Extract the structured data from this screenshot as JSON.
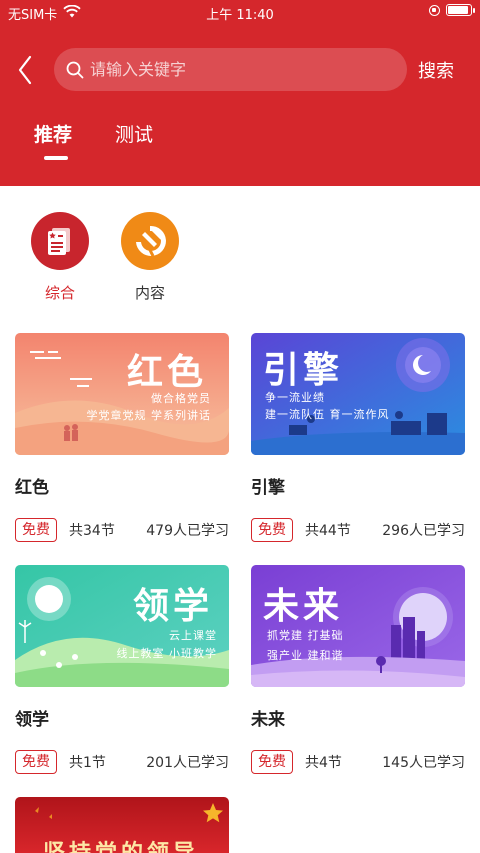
{
  "status_bar": {
    "carrier": "无SIM卡",
    "time": "上午 11:40"
  },
  "search": {
    "placeholder": "请输入关键字",
    "button_label": "搜索"
  },
  "tabs": [
    {
      "label": "推荐",
      "active": true
    },
    {
      "label": "测试",
      "active": false
    }
  ],
  "categories": [
    {
      "label": "综合",
      "icon": "news-document-icon",
      "color": "#c8252d",
      "active": true
    },
    {
      "label": "内容",
      "icon": "party-emblem-icon",
      "color": "#f08a16",
      "active": false
    }
  ],
  "courses": [
    {
      "title": "红色",
      "banner": {
        "title": "红色",
        "lines": [
          "做合格党员",
          "学党章党规  学系列讲话"
        ]
      },
      "badge": "免费",
      "lessons": "共34节",
      "learners": "479人已学习"
    },
    {
      "title": "引擎",
      "banner": {
        "title": "引擎",
        "lines": [
          "争一流业绩",
          "建一流队伍  育一流作风"
        ]
      },
      "badge": "免费",
      "lessons": "共44节",
      "learners": "296人已学习"
    },
    {
      "title": "领学",
      "banner": {
        "title": "领学",
        "lines": [
          "云上课堂",
          "线上教室  小班教学"
        ]
      },
      "badge": "免费",
      "lessons": "共1节",
      "learners": "201人已学习"
    },
    {
      "title": "未来",
      "banner": {
        "title": "未来",
        "lines": [
          "抓党建  打基础",
          "强产业  建和谐"
        ]
      },
      "badge": "免费",
      "lessons": "共4节",
      "learners": "145人已学习"
    },
    {
      "banner": {
        "title": "坚持党的领导"
      }
    }
  ],
  "colors": {
    "brand_red": "#d5272c",
    "orange": "#f08a16"
  }
}
